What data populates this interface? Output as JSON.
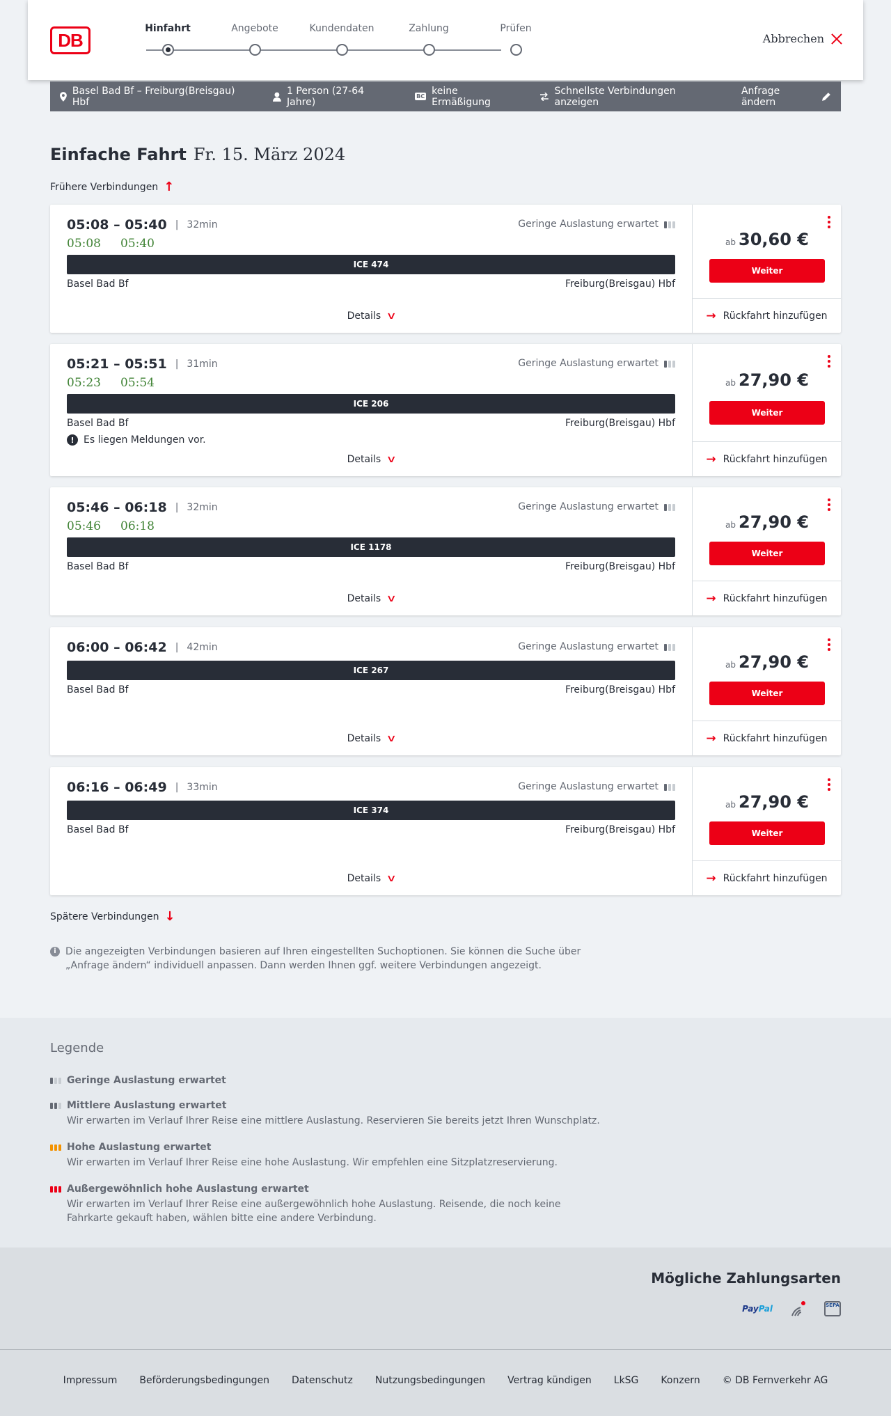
{
  "header": {
    "logo": "DB",
    "cancel_label": "Abbrechen",
    "steps": [
      {
        "label": "Hinfahrt",
        "active": true
      },
      {
        "label": "Angebote",
        "active": false
      },
      {
        "label": "Kundendaten",
        "active": false
      },
      {
        "label": "Zahlung",
        "active": false
      },
      {
        "label": "Prüfen",
        "active": false
      }
    ]
  },
  "search": {
    "route": "Basel Bad Bf – Freiburg(Breisgau) Hbf",
    "persons": "1 Person (27-64 Jahre)",
    "bc_badge": "BC",
    "discount": "keine Ermäßigung",
    "fastest": "Schnellste Verbindungen anzeigen",
    "change": "Anfrage ändern"
  },
  "heading": {
    "title": "Einfache Fahrt",
    "date": "Fr. 15. März 2024",
    "earlier": "Frühere Verbindungen",
    "later": "Spätere Verbindungen"
  },
  "connections": [
    {
      "times": "05:08 – 05:40",
      "duration": "32min",
      "rt_dep": "05:08",
      "rt_arr": "05:40",
      "load": "Geringe Auslastung erwartet",
      "train": "ICE 474",
      "from": "Basel Bad Bf",
      "to": "Freiburg(Breisgau) Hbf",
      "message": "",
      "details": "Details",
      "price_prefix": "ab",
      "price": "30,60 €",
      "button": "Weiter",
      "return": "Rückfahrt hinzufügen"
    },
    {
      "times": "05:21 – 05:51",
      "duration": "31min",
      "rt_dep": "05:23",
      "rt_arr": "05:54",
      "load": "Geringe Auslastung erwartet",
      "train": "ICE 206",
      "from": "Basel Bad Bf",
      "to": "Freiburg(Breisgau) Hbf",
      "message": "Es liegen Meldungen vor.",
      "details": "Details",
      "price_prefix": "ab",
      "price": "27,90 €",
      "button": "Weiter",
      "return": "Rückfahrt hinzufügen"
    },
    {
      "times": "05:46 – 06:18",
      "duration": "32min",
      "rt_dep": "05:46",
      "rt_arr": "06:18",
      "load": "Geringe Auslastung erwartet",
      "train": "ICE 1178",
      "from": "Basel Bad Bf",
      "to": "Freiburg(Breisgau) Hbf",
      "message": "",
      "details": "Details",
      "price_prefix": "ab",
      "price": "27,90 €",
      "button": "Weiter",
      "return": "Rückfahrt hinzufügen"
    },
    {
      "times": "06:00 – 06:42",
      "duration": "42min",
      "rt_dep": "",
      "rt_arr": "",
      "load": "Geringe Auslastung erwartet",
      "train": "ICE 267",
      "from": "Basel Bad Bf",
      "to": "Freiburg(Breisgau) Hbf",
      "message": "",
      "details": "Details",
      "price_prefix": "ab",
      "price": "27,90 €",
      "button": "Weiter",
      "return": "Rückfahrt hinzufügen"
    },
    {
      "times": "06:16 – 06:49",
      "duration": "33min",
      "rt_dep": "",
      "rt_arr": "",
      "load": "Geringe Auslastung erwartet",
      "train": "ICE 374",
      "from": "Basel Bad Bf",
      "to": "Freiburg(Breisgau) Hbf",
      "message": "",
      "details": "Details",
      "price_prefix": "ab",
      "price": "27,90 €",
      "button": "Weiter",
      "return": "Rückfahrt hinzufügen"
    }
  ],
  "info": "Die angezeigten Verbindungen basieren auf Ihren eingestellten Suchoptionen. Sie können die Suche über „Anfrage ändern“ individuell anpassen. Dann werden Ihnen ggf. weitere Verbindungen angezeigt.",
  "legend": {
    "title": "Legende",
    "items": [
      {
        "title": "Geringe Auslastung erwartet",
        "desc": "",
        "level": 1,
        "color": "#646973"
      },
      {
        "title": "Mittlere Auslastung erwartet",
        "desc": "Wir erwarten im Verlauf Ihrer Reise eine mittlere Auslastung. Reservieren Sie bereits jetzt Ihren Wunschplatz.",
        "level": 2,
        "color": "#646973"
      },
      {
        "title": "Hohe Auslastung erwartet",
        "desc": "Wir erwarten im Verlauf Ihrer Reise eine hohe Auslastung. Wir empfehlen eine Sitzplatzreservierung.",
        "level": 3,
        "color": "#f39200"
      },
      {
        "title": "Außergewöhnlich hohe Auslastung erwartet",
        "desc": "Wir erwarten im Verlauf Ihrer Reise eine außergewöhnlich hohe Auslastung. Reisende, die noch keine Fahrkarte gekauft haben, wählen bitte eine andere Verbindung.",
        "level": 4,
        "color": "#ec0016"
      }
    ]
  },
  "payment": {
    "title": "Mögliche Zahlungsarten",
    "paypal_a": "Pay",
    "paypal_b": "Pal",
    "sepa": "SEPA"
  },
  "footer": {
    "links": [
      "Impressum",
      "Beförderungsbedingungen",
      "Datenschutz",
      "Nutzungsbedingungen",
      "Vertrag kündigen",
      "LkSG",
      "Konzern",
      "© DB Fernverkehr AG"
    ]
  },
  "colors": {
    "accent": "#ec0016",
    "realtime": "#408335",
    "bar": "#646973",
    "dark": "#282d37"
  }
}
